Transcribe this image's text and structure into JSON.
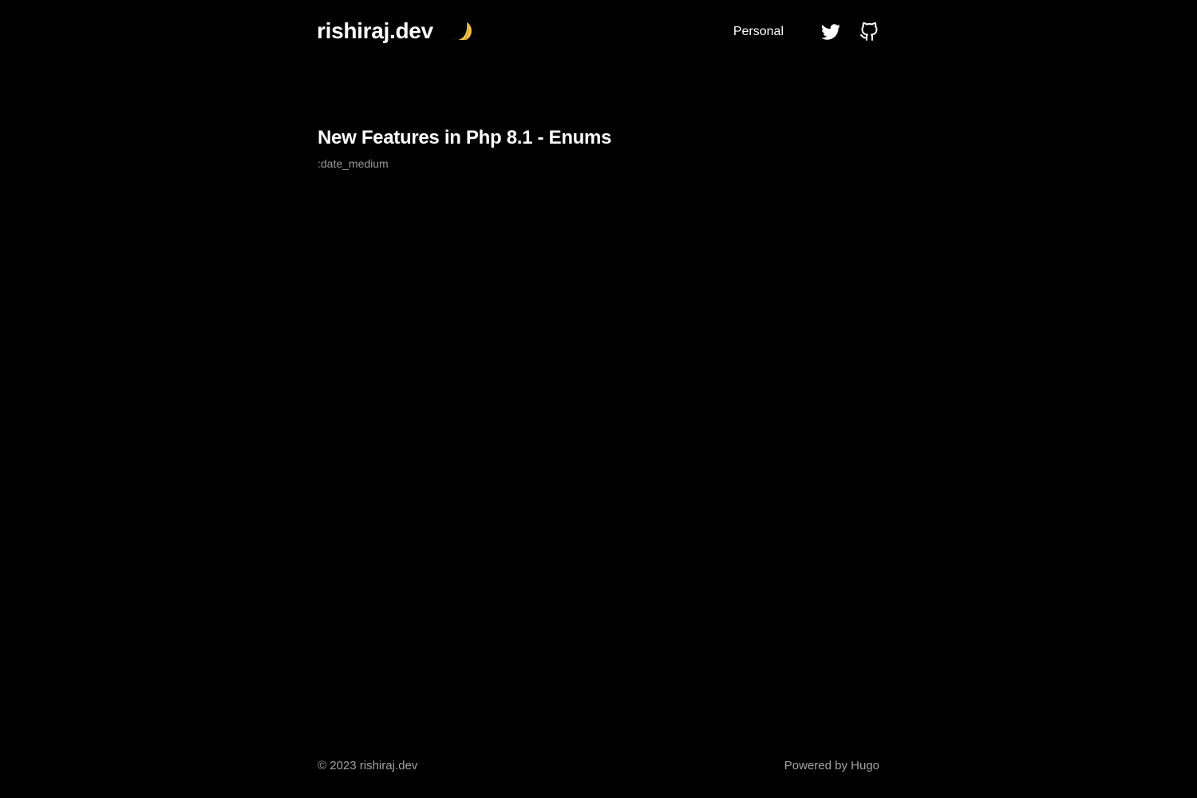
{
  "header": {
    "site_name": "rishiraj.dev",
    "theme_toggle_icon": "moon-icon",
    "nav": {
      "links": [
        {
          "label": "Personal"
        }
      ],
      "social": [
        {
          "icon": "twitter-icon"
        },
        {
          "icon": "github-icon"
        }
      ]
    }
  },
  "main": {
    "post_title": "New Features in Php 8.1 - Enums",
    "post_date": ":date_medium"
  },
  "footer": {
    "copyright": "© 2023 rishiraj.dev",
    "powered_prefix": "Powered by ",
    "powered_link": "Hugo"
  },
  "colors": {
    "background": "#000000",
    "text": "#ffffff",
    "muted": "#9a9a9a",
    "moon": "#f5c542"
  }
}
